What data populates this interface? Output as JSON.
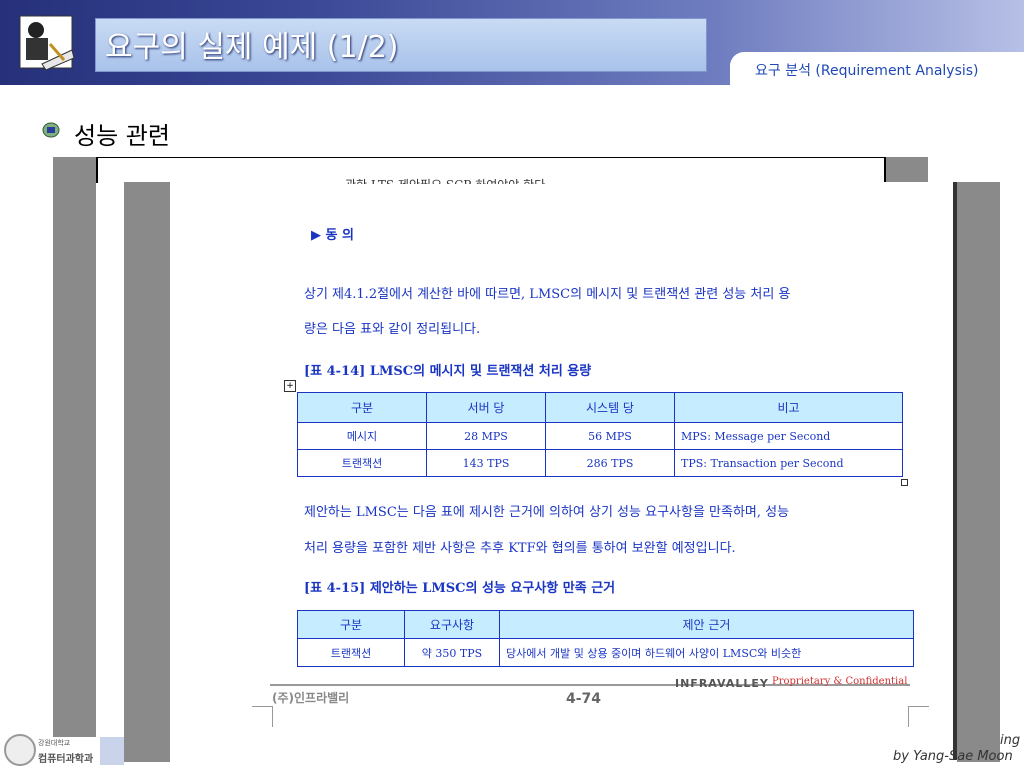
{
  "slide": {
    "title": "요구의 실제 예제 (1/2)",
    "subtitle": "요구 분석 (Requirement Analysis)",
    "section_heading": "성능 관련",
    "footer_school": "강원대학교",
    "footer_dept": "컴퓨터과학과",
    "footer_right_1": "ing",
    "footer_right_2": "by Yang-Sae Moon"
  },
  "document": {
    "cut_line": "관한 LTS 제안필요 SCP 하여야야 한다.",
    "agree_heading": "▶ 동 의",
    "para1_line1": "상기 제4.1.2절에서 계산한 바에 따르면, LMSC의 메시지 및 트랜잭션 관련 성능 처리 용",
    "para1_line2": "량은 다음 표와 같이 정리됩니다.",
    "table1_caption": "[표 4-14] LMSC의 메시지 및 트랜잭션 처리 용량",
    "table1": {
      "headers": [
        "구분",
        "서버 당",
        "시스템 당",
        "비고"
      ],
      "rows": [
        [
          "메시지",
          "28 MPS",
          "56 MPS",
          "MPS: Message per Second"
        ],
        [
          "트랜잭션",
          "143 TPS",
          "286 TPS",
          "TPS: Transaction per Second"
        ]
      ]
    },
    "para2_line1": "제안하는 LMSC는 다음 표에 제시한 근거에 의하여 상기 성능 요구사항을 만족하며, 성능",
    "para2_line2": "처리 용량을 포함한 제반 사항은 추후 KTF와 협의를 통하여 보완할 예정입니다.",
    "table2_caption": "[표 4-15] 제안하는 LMSC의 성능 요구사항 만족 근거",
    "table2": {
      "headers": [
        "구분",
        "요구사항",
        "제안 근거"
      ],
      "rows": [
        [
          "트랜잭션",
          "약 350 TPS",
          "당사에서 개발 및 상용 중이며 하드웨어 사양이 LMSC와 비슷한"
        ]
      ]
    },
    "footer_company": "(주)인프라밸리",
    "footer_brand": "INFRAVALLEY",
    "footer_confidential": "Proprietary & Confidential",
    "page_number": "4-74"
  },
  "colors": {
    "header_dark": "#26307a",
    "doc_text": "#1a35c4",
    "table_header_bg": "#c5ecff",
    "confidential": "#d03030"
  }
}
